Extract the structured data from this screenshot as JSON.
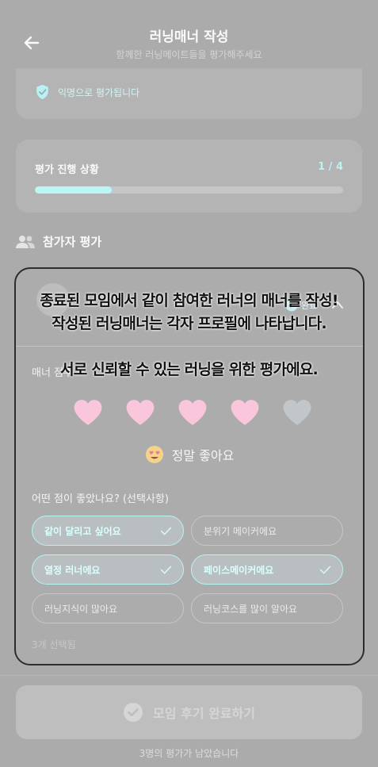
{
  "header": {
    "title": "러닝매너 작성",
    "subtitle": "함께한 러닝메이트들을 평가해주세요"
  },
  "anonymous": {
    "text": "익명으로 평가됩니다"
  },
  "progress": {
    "label": "평가 진행 상황",
    "count": "1 / 4",
    "fraction": 0.25
  },
  "participants": {
    "heading": "참가자 평가"
  },
  "evaluation": {
    "badge": "완료",
    "manner_label": "매너 점수",
    "hearts": {
      "filled": 4,
      "total": 5
    },
    "rating_text": "정말 좋아요",
    "question": "어떤 점이 좋았나요? (선택사항)",
    "options": [
      {
        "label": "같이 달리고 싶어요",
        "selected": true
      },
      {
        "label": "분위기 메이커에요",
        "selected": false
      },
      {
        "label": "열정 러너에요",
        "selected": true
      },
      {
        "label": "페이스메이커에요",
        "selected": true
      },
      {
        "label": "러닝지식이 많아요",
        "selected": false
      },
      {
        "label": "러닝코스를 많이 알아요",
        "selected": false
      }
    ],
    "selected_count": "3개 선택됨"
  },
  "overlay": {
    "line1": "종료된 모임에서 같이 참여한 러너의 매너를 작성!",
    "line2": "작성된 러닝매너는 각자 프로필에 나타납니다.",
    "line3": "서로 신뢰할 수 있는 러닝을 위한 평가에요."
  },
  "footer": {
    "cta": "모임 후기 완료하기",
    "remaining": "3명의 평가가 남았습니다"
  },
  "colors": {
    "accent": "#b9f6f6",
    "heart_filled": "#f9c6dc",
    "heart_empty": "#c2c6c9"
  }
}
